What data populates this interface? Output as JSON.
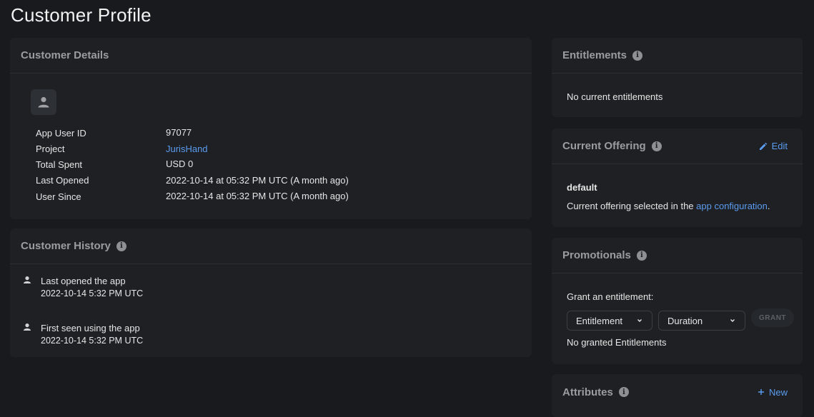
{
  "page": {
    "title": "Customer Profile"
  },
  "customer_details": {
    "title": "Customer Details",
    "rows": [
      {
        "label": "App User ID",
        "value": "97077"
      },
      {
        "label": "Project",
        "value": "JurisHand"
      },
      {
        "label": "Total Spent",
        "value": "USD 0"
      },
      {
        "label": "Last Opened",
        "value": "2022-10-14 at 05:32 PM UTC (A month ago)"
      },
      {
        "label": "User Since",
        "value": "2022-10-14 at 05:32 PM UTC (A month ago)"
      }
    ]
  },
  "customer_history": {
    "title": "Customer History",
    "items": [
      {
        "title": "Last opened the app",
        "time": "2022-10-14 5:32 PM UTC"
      },
      {
        "title": "First seen using the app",
        "time": "2022-10-14 5:32 PM UTC"
      }
    ]
  },
  "entitlements": {
    "title": "Entitlements",
    "empty_text": "No current entitlements"
  },
  "current_offering": {
    "title": "Current Offering",
    "edit_label": "Edit",
    "name": "default",
    "desc_prefix": "Current offering selected in the ",
    "desc_link": "app configuration",
    "desc_suffix": "."
  },
  "promotionals": {
    "title": "Promotionals",
    "grant_label": "Grant an entitlement:",
    "entitlement_select": "Entitlement",
    "duration_select": "Duration",
    "grant_button": "GRANT",
    "empty_text": "No granted Entitlements"
  },
  "attributes": {
    "title": "Attributes",
    "new_label": "New"
  },
  "colors": {
    "accent": "#5b9cf0",
    "card": "#1e2023",
    "background": "#181a1d"
  }
}
